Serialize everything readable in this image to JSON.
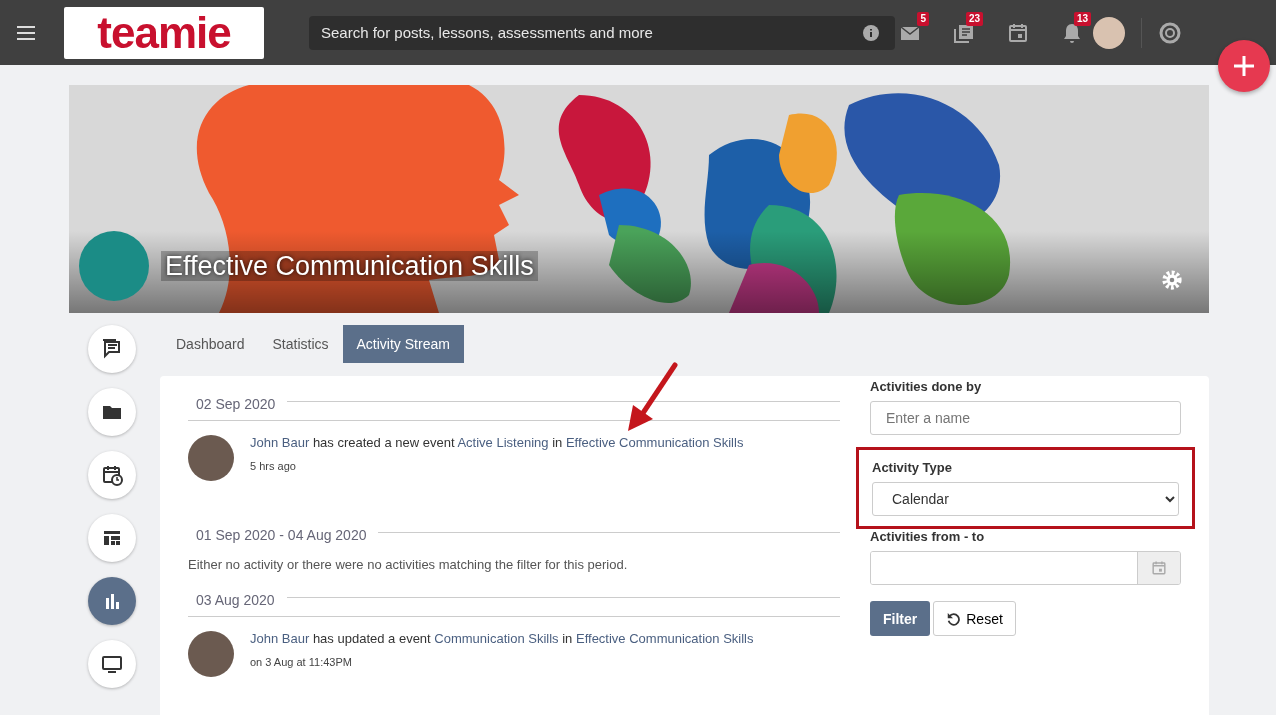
{
  "topbar": {
    "logo": "teamie",
    "search": {
      "placeholder": "Search for posts, lessons, assessments and more"
    },
    "badges": {
      "mail": "5",
      "posts": "23",
      "alerts": "13"
    }
  },
  "banner": {
    "title": "Effective Communication Skills"
  },
  "rail": [
    {
      "selected": false
    },
    {
      "selected": false
    },
    {
      "selected": false
    },
    {
      "selected": false
    },
    {
      "selected": true
    },
    {
      "selected": false
    }
  ],
  "tabs": [
    {
      "label": "Dashboard",
      "selected": false
    },
    {
      "label": "Statistics",
      "selected": false
    },
    {
      "label": "Activity Stream",
      "selected": true
    }
  ],
  "stream": [
    {
      "kind": "date",
      "label": "02 Sep 2020"
    },
    {
      "kind": "activity",
      "actor": "John Baur",
      "action": "has created a new event",
      "object": "Active Listening",
      "preposition": "in",
      "course": "Effective Communication Skills",
      "time": "5 hrs ago"
    },
    {
      "kind": "date",
      "label": "01 Sep 2020 - 04 Aug 2020"
    },
    {
      "kind": "empty",
      "text": "Either no activity or there were no activities matching the filter for this period."
    },
    {
      "kind": "date",
      "label": "03 Aug 2020"
    },
    {
      "kind": "activity",
      "actor": "John Baur",
      "action": "has updated a event",
      "object": "Communication Skills",
      "preposition": "in",
      "course": "Effective Communication Skills",
      "time": "on 3 Aug at 11:43PM"
    }
  ],
  "filters": {
    "done_by": {
      "label": "Activities done by",
      "placeholder": "Enter a name"
    },
    "activity_type": {
      "label": "Activity Type",
      "value": "Calendar",
      "highlighted": true
    },
    "date_range": {
      "label": "Activities from - to"
    },
    "buttons": {
      "filter": "Filter",
      "reset": "Reset"
    }
  }
}
